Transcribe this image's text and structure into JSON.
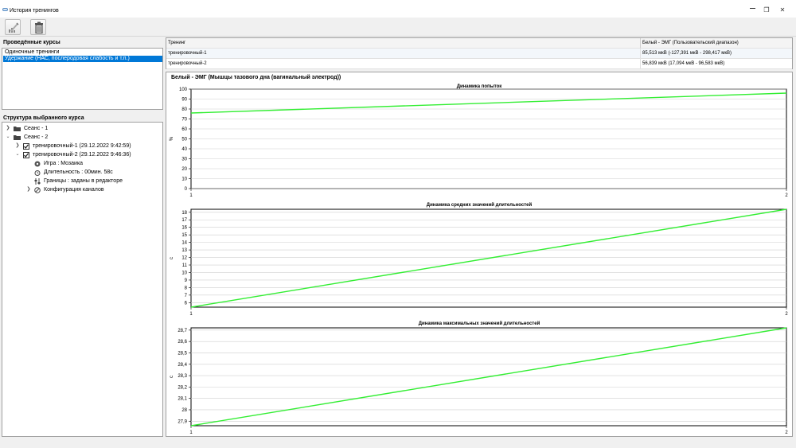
{
  "window": {
    "title": "История тренингов",
    "restore_glyph": "❐",
    "close_glyph": "✕"
  },
  "toolbar": {
    "edit_icon": "pencil-chart-icon",
    "delete_icon": "trash-icon"
  },
  "courses": {
    "header": "Проведённые курсы",
    "items": [
      {
        "label": "Одиночные тренинги",
        "selected": false
      },
      {
        "label": "Удержание (НАС, послеродовая слабость и т.п.)",
        "selected": true
      }
    ]
  },
  "structure": {
    "header": "Структура выбранного курса",
    "rows": [
      {
        "label": "Сеанс - 1",
        "chevron": ">",
        "icon": "folder-icon",
        "level": 0
      },
      {
        "label": "Сеанс - 2",
        "chevron": "v",
        "icon": "folder-icon",
        "level": 0
      },
      {
        "label": "тренировочный-1 (29.12.2022 9:42:59)",
        "chevron": ">",
        "icon": "checkbox-icon",
        "level": 1
      },
      {
        "label": "тренировочный-2 (29.12.2022 9:46:36)",
        "chevron": "v",
        "icon": "checkbox-icon",
        "level": 1
      },
      {
        "label": "Игра : Мозаика",
        "chevron": "",
        "icon": "gamepad-icon",
        "level": 2
      },
      {
        "label": "Длительность : 00мин. 58с",
        "chevron": "",
        "icon": "alarm-clock-icon",
        "level": 2
      },
      {
        "label": "Границы : заданы в редакторе",
        "chevron": "",
        "icon": "sliders-icon",
        "level": 2
      },
      {
        "label": "Конфигурация каналов",
        "chevron": ">",
        "icon": "channels-icon",
        "level": 2
      }
    ]
  },
  "grid": {
    "columns": [
      "Тренинг",
      "Белый - ЭМГ (Пользовательский диапазон)"
    ],
    "rows": [
      [
        "тренировочный-1",
        "85,513 мкВ (-127,391 мкВ - 298,417 мкВ)"
      ],
      [
        "тренировочный-2",
        "56,839 мкВ (17,094 мкВ - 96,583 мкВ)"
      ]
    ]
  },
  "charts_title": "Белый - ЭМГ (Мышцы тазового дна (вагинальный электрод))",
  "line_color": "#33ee33",
  "chart_data": [
    {
      "type": "line",
      "title": "Динамика попыток",
      "ylabel": "%",
      "x": [
        1,
        2
      ],
      "values": [
        76,
        96
      ],
      "ylim": [
        0,
        100
      ],
      "yticks": [
        "0",
        "10",
        "20",
        "30",
        "40",
        "50",
        "60",
        "70",
        "80",
        "90",
        "100"
      ],
      "xticks": [
        "1",
        "2"
      ],
      "grid": true
    },
    {
      "type": "line",
      "title": "Динамика средних значений длительностей",
      "ylabel": "с",
      "x": [
        1,
        2
      ],
      "values": [
        5.4,
        18.4
      ],
      "ylim": [
        5.4,
        18.4
      ],
      "yticks": [
        "6",
        "7",
        "8",
        "9",
        "10",
        "11",
        "12",
        "13",
        "14",
        "15",
        "16",
        "17",
        "18"
      ],
      "xticks": [
        "1",
        "2"
      ],
      "grid": true
    },
    {
      "type": "line",
      "title": "Динамика максимальных значений длительностей",
      "ylabel": "с",
      "x": [
        1,
        2
      ],
      "values": [
        27.86,
        28.72
      ],
      "ylim": [
        27.86,
        28.72
      ],
      "yticks": [
        "27,9",
        "28",
        "28,1",
        "28,2",
        "28,3",
        "28,4",
        "28,5",
        "28,6",
        "28,7"
      ],
      "xticks": [
        "1",
        "2"
      ],
      "grid": true
    }
  ]
}
